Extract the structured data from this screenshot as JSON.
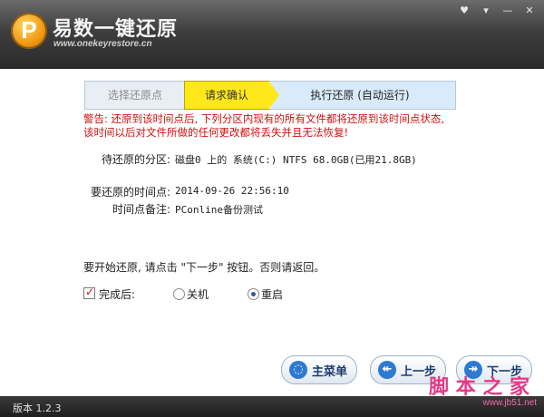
{
  "app": {
    "title": "易数一键还原",
    "url": "www.onekeyrestore.cn",
    "logo_letter": "P"
  },
  "window_buttons": [
    "gift-icon",
    "menu-icon",
    "minimize-icon",
    "close-icon"
  ],
  "window_button_glyphs": [
    "♥",
    "▾",
    "—",
    "✕"
  ],
  "steps": [
    {
      "label": "选择还原点",
      "state": "done"
    },
    {
      "label": "请求确认",
      "state": "active"
    },
    {
      "label": "执行还原 (自动运行)",
      "state": "pending"
    }
  ],
  "warning": "警告: 还原到该时间点后, 下列分区内现有的所有文件都将还原到该时间点状态, 该时间以后对文件所做的任何更改都将丢失并且无法恢复!",
  "details": {
    "partition_label": "待还原的分区:",
    "partition_value": "磁盘0 上的 系统(C:) NTFS 68.0GB(已用21.8GB)",
    "time_label": "要还原的时间点:",
    "time_value": "2014-09-26 22:56:10",
    "note_label": "时间点备注:",
    "note_value": "PConline备份测试"
  },
  "prompt": "要开始还原, 请点击 \"下一步\" 按钮。否则请返回。",
  "options": {
    "after_label": "完成后:",
    "after_checked": true,
    "shutdown_label": "关机",
    "restart_label": "重启",
    "selected": "restart"
  },
  "buttons": {
    "main_menu": "主菜单",
    "prev": "上一步",
    "next": "下一步"
  },
  "status": {
    "version": "版本 1.2.3"
  },
  "watermark": {
    "text": "脚 本 之 家",
    "url": "www.jb51.net"
  },
  "colors": {
    "active_step": "#ffe81a",
    "warning": "#d01010",
    "titlebar": "#3e3e3e"
  }
}
